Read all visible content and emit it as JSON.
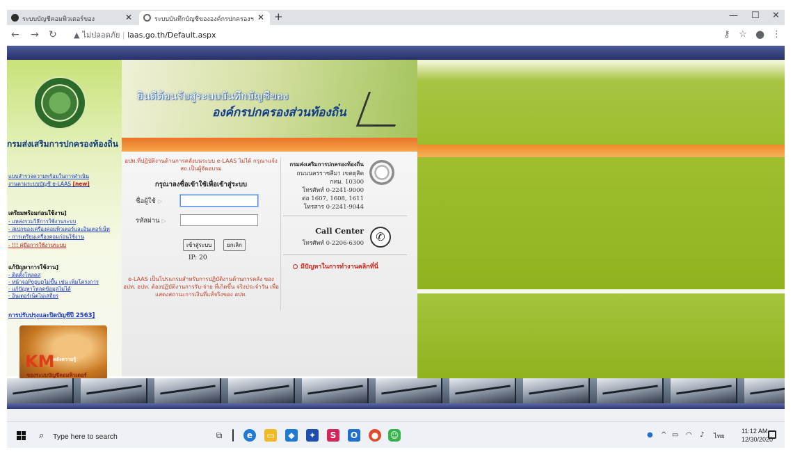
{
  "browser": {
    "tabs": [
      {
        "title": "ระบบบัญชีคอมพิวเตอร์ของ"
      },
      {
        "title": "ระบบบันทึกบัญชีขององค์กรปกครองฯ"
      }
    ],
    "new_tab_symbol": "+",
    "security_label": "ไม่ปลอดภัย",
    "url": "laas.go.th/Default.aspx"
  },
  "left_panel": {
    "dept_name": "กรมส่งเสริมการปกครองท้องถิ่น",
    "survey_link": "แบบสำรวจความพร้อมในการดำเนิน",
    "survey_link2": "งานตามระบบบัญชี e-LAAS",
    "new_badge": "[new]",
    "prep_heading": "เตรียมพร้อมก่อนใช้งาน]",
    "prep_links": [
      "- แหล่งรวมวิธีการใช้งานระบบ",
      "- สเปกของเครื่องคอมพิวเตอร์และอินเตอร์เน็ท",
      "- การเตรียมเครื่องคอมก่อนใช้งาน",
      "- !!! คู่มือการใช้งานระบบ"
    ],
    "issues_heading": "แก้ปัญหาการใช้งาน]",
    "issue_links": [
      "- ติดตั้งโหลดส",
      "- หน้าจอPopupไม่ขึ้น เช่น เพิ่มโครงการ",
      "- แก้ปัญหาโหลดข้อมูลไม่ได้",
      "- อินเตอร์เน็ตไม่เสถียร"
    ],
    "budget_link": "การปรับปรุงและปิดบัญชีปี 2563]",
    "km_logo": "KM",
    "km_sub": "คลังความรู้",
    "km_caption": "ของระบบบัญชีคอมพิวเตอร์"
  },
  "banner": {
    "line1": "ยินดีต้อนรับสู่ระบบบันทึกบัญชีของ",
    "line2": "องค์กรปกครองส่วนท้องถิ่น"
  },
  "login": {
    "note": "อปท.ที่ปฏิบัติงานด้านการคลังบนระบบ e-LAAS ไม่ได้ กรุณาแจ้ง สถ.เป็นผู้จัดอบรม",
    "title": "กรุณาลงชื่อเข้าใช้เพื่อเข้าสู่ระบบ",
    "username_label": "ชื่อผู้ใช้",
    "password_label": "รหัสผ่าน",
    "username_value": "",
    "password_value": "",
    "login_button": "เข้าสู่ระบบ",
    "cancel_button": "ยกเลิก",
    "ip_label": "IP: 20",
    "description": "e-LAAS เป็นโปรแกรมสำหรับการปฏิบัติงานด้านการคลัง ของ อปท. อปท. ต้องปฏิบัติงานการรับ-จ่าย ที่เกิดขึ้น จริงประจำวัน เพื่อแสดงสถานะการเงินที่แท้จริงของ อปท."
  },
  "contact": {
    "org": "กรมส่งเสริมการปกครองท้องถิ่น",
    "address": [
      "ถนนนครราชสีมา เขตดุสิต",
      "กทม. 10300",
      "โทรศัพท์ 0-2241-9000",
      "ต่อ 1607, 1608, 1611",
      "โทรสาร 0-2241-9044"
    ],
    "call_center_title": "Call Center",
    "call_center_phone": "โทรศัพท์ 0-2206-6300",
    "problem_link": "มีปัญหาในการทำงานคลิกที่นี่"
  },
  "taskbar": {
    "search_placeholder": "Type here to search",
    "tray_lang": "ไทย",
    "time": "11:12 AM",
    "date": "12/30/2020"
  },
  "colors": {
    "accent_green": "#9dbd2e",
    "accent_orange": "#f08a2a",
    "header_blue": "#27306a",
    "link_blue": "#1a35c2",
    "alert_red": "#d0231a"
  }
}
